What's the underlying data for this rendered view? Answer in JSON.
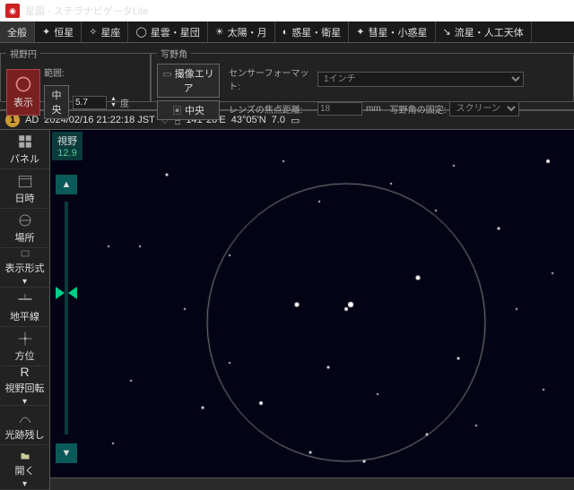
{
  "title": "星図 - ステラナビゲータLite",
  "tabs": [
    {
      "label": "全般",
      "active": true
    },
    {
      "label": "恒星"
    },
    {
      "label": "星座"
    },
    {
      "label": "星雲・星団"
    },
    {
      "label": "太陽・月"
    },
    {
      "label": "惑星・衛星"
    },
    {
      "label": "彗星・小惑星"
    },
    {
      "label": "流星・人工天体"
    }
  ],
  "ribbon": {
    "fov_circle": {
      "legend": "視野円",
      "show": "表示",
      "center": "中央",
      "range_label": "範囲:",
      "range_value": "5.7",
      "unit": "度"
    },
    "fov_angle": {
      "legend": "写野角",
      "imaging_area": "撮像エリア",
      "center": "中央",
      "sensor_format_label": "センサーフォーマット:",
      "sensor_format_value": "1インチ",
      "focal_length_label": "レンズの焦点距離:",
      "focal_length_value": "18",
      "focal_unit": "mm",
      "fix_label": "写野角の固定:",
      "fix_value": "スクリーン"
    }
  },
  "status": {
    "num": "1",
    "era": "AD",
    "datetime": "2024/02/16 21:22:18 JST",
    "lon": "141°20'E",
    "lat": "43°05'N",
    "mag": "7.0"
  },
  "sidebar": [
    {
      "label": "パネル"
    },
    {
      "label": "日時"
    },
    {
      "label": "場所"
    },
    {
      "label": "表示形式"
    },
    {
      "label": "地平線"
    },
    {
      "label": "方位"
    },
    {
      "label": "視野回転"
    },
    {
      "label": "光跡残し"
    },
    {
      "label": "開く"
    }
  ],
  "canvas": {
    "fov_label": "視野",
    "fov_value": "12.9"
  }
}
